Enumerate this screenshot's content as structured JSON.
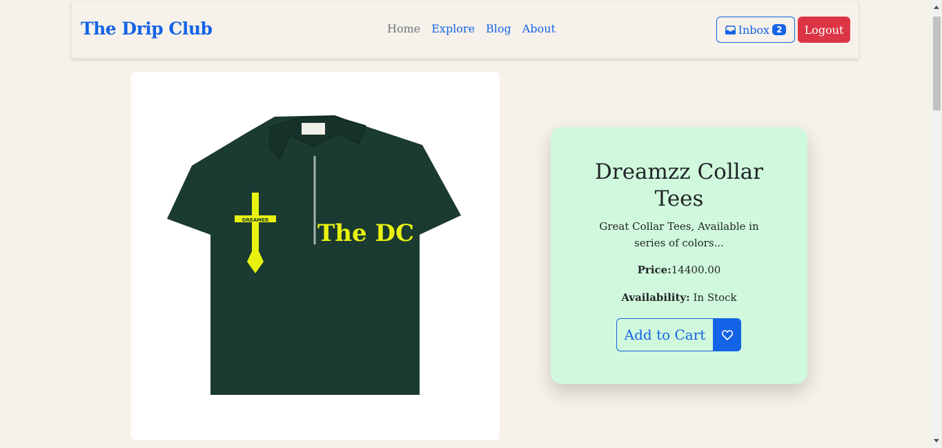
{
  "nav": {
    "brand": "The Drip Club",
    "links": [
      {
        "label": "Home",
        "active": false
      },
      {
        "label": "Explore",
        "active": true
      },
      {
        "label": "Blog",
        "active": true
      },
      {
        "label": "About",
        "active": true
      }
    ],
    "inbox_label": "Inbox",
    "inbox_count": "2",
    "logout_label": "Logout"
  },
  "product": {
    "title": "Dreamzz Collar Tees",
    "description": "Great Collar Tees, Available in series of colors...",
    "price_label": "Price:",
    "price_value": "14400.00",
    "availability_label": "Availability:",
    "availability_value": "In Stock",
    "add_to_cart_label": "Add to Cart",
    "shirt_print_text": "The DC",
    "shirt_cross_text": "DREAMER",
    "shirt_color": "#1b3a31",
    "print_color": "#e8f20f"
  }
}
